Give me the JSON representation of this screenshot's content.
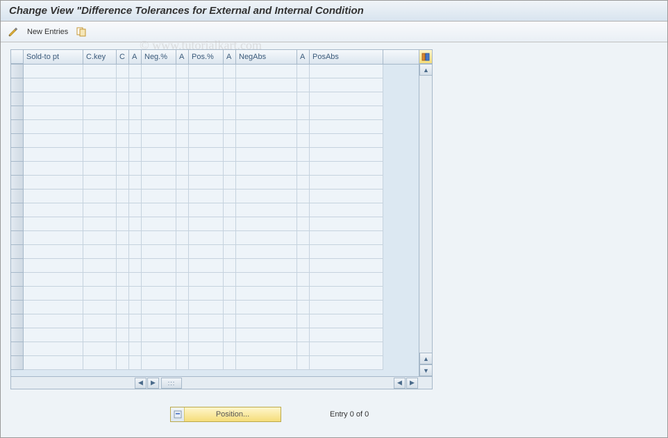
{
  "title": "Change View \"Difference Tolerances for External and Internal Condition",
  "toolbar": {
    "new_entries_label": "New Entries"
  },
  "table": {
    "columns": {
      "sold_to_pt": "Sold-to pt",
      "c_key": "C.key",
      "c": "C",
      "a1": "A",
      "neg_pct": "Neg.%",
      "a2": "A",
      "pos_pct": "Pos.%",
      "a3": "A",
      "neg_abs": "NegAbs",
      "a4": "A",
      "pos_abs": "PosAbs"
    }
  },
  "footer": {
    "position_label": "Position...",
    "entry_status": "Entry 0 of 0"
  },
  "watermark": "© www.tutorialkart.com",
  "hscroll_dots": ":::"
}
